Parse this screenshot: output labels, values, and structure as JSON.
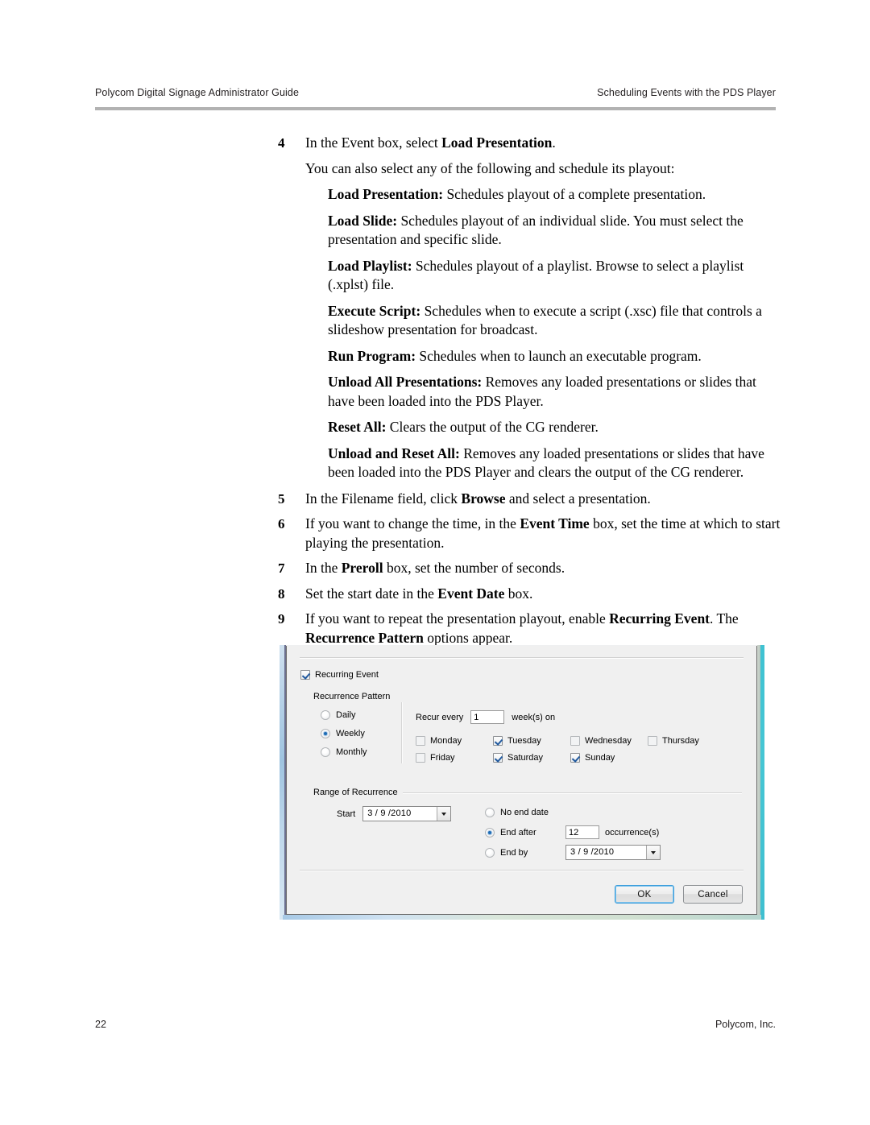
{
  "header": {
    "left": "Polycom Digital Signage Administrator Guide",
    "right": "Scheduling Events with the PDS Player"
  },
  "footer": {
    "page_number": "22",
    "company": "Polycom, Inc."
  },
  "body": {
    "step4": {
      "number": "4",
      "text_before": "In the Event box, select ",
      "bold": "Load Presentation",
      "text_after": "."
    },
    "intro_paragraph": "You can also select any of the following and schedule its playout:",
    "definitions": [
      {
        "term": "Load Presentation:",
        "description": " Schedules playout of a complete presentation."
      },
      {
        "term": "Load Slide:",
        "description": " Schedules playout of an individual slide. You must select the presentation and specific slide."
      },
      {
        "term": "Load Playlist:",
        "description": " Schedules playout of a playlist. Browse to select a playlist (.xplst) file."
      },
      {
        "term": "Execute Script:",
        "description": " Schedules when to execute a script (.xsc) file that controls a slideshow presentation for broadcast."
      },
      {
        "term": "Run Program:",
        "description": " Schedules when to launch an executable program."
      },
      {
        "term": "Unload All Presentations:",
        "description": " Removes any loaded presentations or slides that have been loaded into the PDS Player."
      },
      {
        "term": "Reset All:",
        "description": " Clears the output of the CG renderer."
      },
      {
        "term": "Unload and Reset All:",
        "description": " Removes any loaded presentations or slides that have been loaded into the PDS Player and clears the output of the CG renderer."
      }
    ],
    "step5": {
      "number": "5",
      "part1": "In the Filename field, click ",
      "bold": "Browse",
      "part2": " and select a presentation."
    },
    "step6": {
      "number": "6",
      "part1": "If you want to change the time, in the ",
      "bold": "Event Time",
      "part2": " box, set the time at which to start playing the presentation."
    },
    "step7": {
      "number": "7",
      "part1": "In the ",
      "bold": "Preroll",
      "part2": " box, set the number of seconds."
    },
    "step8": {
      "number": "8",
      "part1": "Set the start date in the ",
      "bold": "Event Date",
      "part2": " box."
    },
    "step9": {
      "number": "9",
      "part1": "If you want to repeat the presentation playout, enable ",
      "bold1": "Recurring Event",
      "part2": ". The ",
      "bold2": "Recurrence Pattern",
      "part3": " options appear."
    }
  },
  "dialog": {
    "recurring_event": {
      "label": "Recurring Event",
      "checked": true
    },
    "recurrence_pattern": {
      "group_label": "Recurrence Pattern",
      "options": [
        {
          "label": "Daily",
          "selected": false
        },
        {
          "label": "Weekly",
          "selected": true
        },
        {
          "label": "Monthly",
          "selected": false
        }
      ],
      "recur_every_label": "Recur every",
      "recur_every_value": "1",
      "recur_every_suffix": "week(s) on",
      "days": [
        {
          "label": "Monday",
          "checked": false
        },
        {
          "label": "Tuesday",
          "checked": true
        },
        {
          "label": "Wednesday",
          "checked": false
        },
        {
          "label": "Thursday",
          "checked": false
        },
        {
          "label": "Friday",
          "checked": false
        },
        {
          "label": "Saturday",
          "checked": true
        },
        {
          "label": "Sunday",
          "checked": true
        }
      ]
    },
    "range_of_recurrence": {
      "group_label": "Range of Recurrence",
      "start_label": "Start",
      "start_value": "3 / 9 /2010",
      "no_end_date_label": "No end date",
      "no_end_date_selected": false,
      "end_after_label": "End after",
      "end_after_selected": true,
      "end_after_value": "12",
      "occurrences_label": "occurrence(s)",
      "end_by_label": "End by",
      "end_by_selected": false,
      "end_by_value": "3 / 9 /2010"
    },
    "buttons": {
      "ok": "OK",
      "cancel": "Cancel"
    }
  },
  "colors": {
    "rule": "#b2b2b2",
    "accent_blue": "#3c9ddb",
    "radio_dot": "#1e6cb5",
    "check_mark": "#21599e",
    "dialog_bg": "#f0f0f0",
    "edge_teal": "#3fc2d2"
  }
}
